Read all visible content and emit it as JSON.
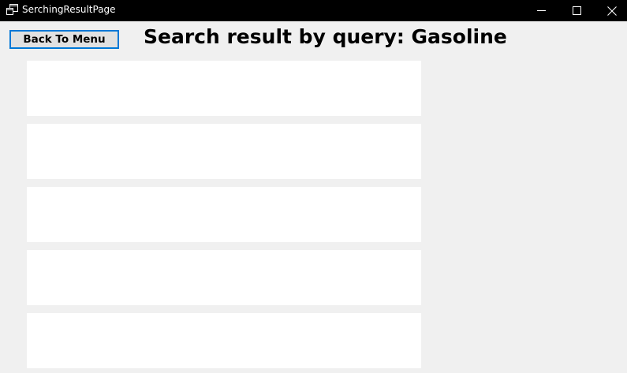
{
  "window": {
    "title": "SerchingResultPage",
    "icon": "app-window-icon",
    "controls": [
      "minimize-icon",
      "maximize-icon",
      "close-icon"
    ]
  },
  "toolbar": {
    "back_label": "Back To Menu"
  },
  "header": {
    "title": "Search result by query: Gasoline"
  },
  "results": {
    "items": [
      {
        "text": ""
      },
      {
        "text": ""
      },
      {
        "text": ""
      },
      {
        "text": ""
      },
      {
        "text": ""
      }
    ]
  },
  "colors": {
    "titlebar_bg": "#000000",
    "client_bg": "#f0f0f0",
    "button_border": "#0078d7",
    "result_bg": "#ffffff"
  }
}
